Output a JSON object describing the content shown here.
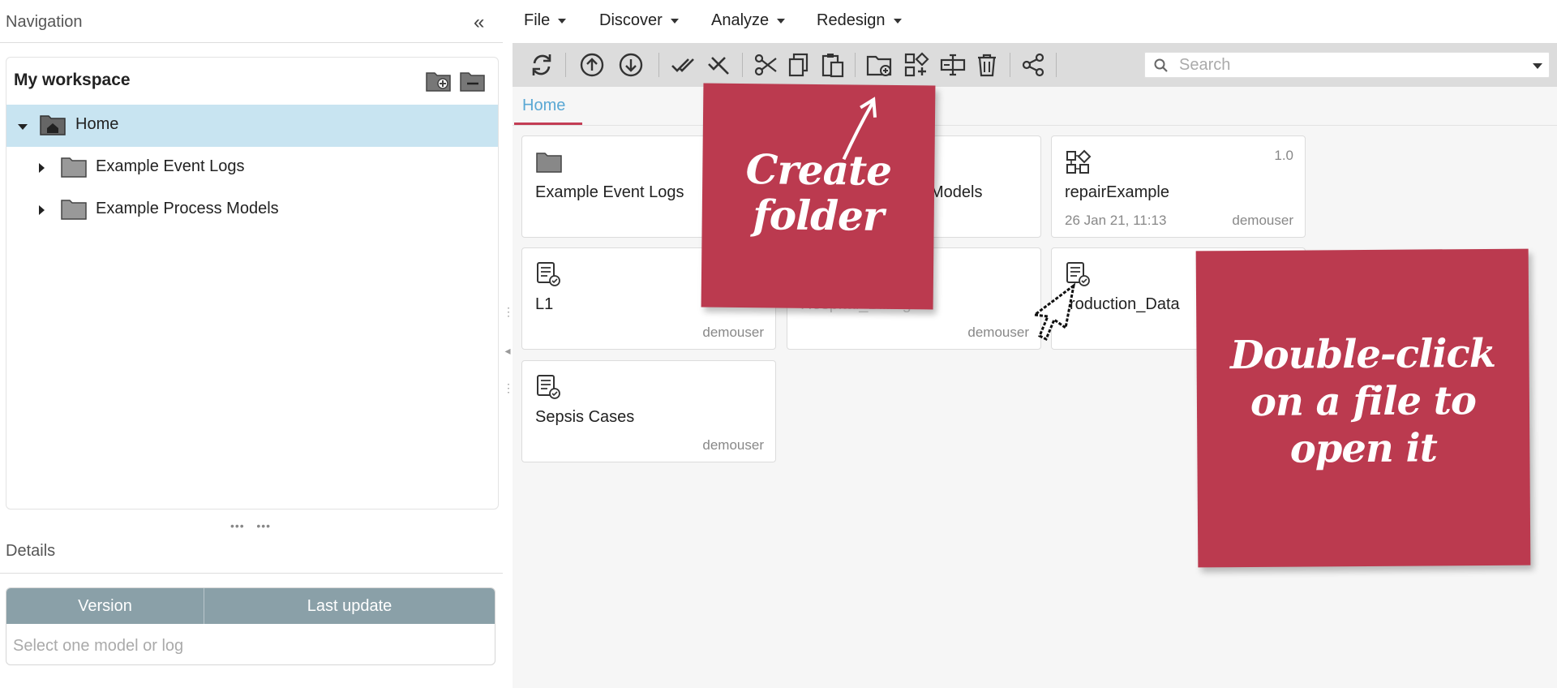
{
  "navigation": {
    "title": "Navigation",
    "collapse_icon": "double-chevron-left-icon",
    "workspace": {
      "title": "My workspace",
      "tree": [
        {
          "label": "Home",
          "selected": true,
          "expanded": true,
          "icon": "home-folder-icon"
        },
        {
          "label": "Example Event Logs",
          "selected": false,
          "expanded": false,
          "icon": "folder-icon"
        },
        {
          "label": "Example Process Models",
          "selected": false,
          "expanded": false,
          "icon": "folder-icon"
        }
      ]
    }
  },
  "details": {
    "title": "Details",
    "columns": [
      "Version",
      "Last update"
    ],
    "empty_text": "Select one model or log"
  },
  "menu": {
    "items": [
      "File",
      "Discover",
      "Analyze",
      "Redesign"
    ]
  },
  "toolbar": {
    "buttons": [
      "refresh-icon",
      "upload-icon",
      "download-icon",
      "select-all-icon",
      "deselect-all-icon",
      "cut-icon",
      "copy-icon",
      "paste-icon",
      "new-folder-icon",
      "new-model-icon",
      "rename-icon",
      "delete-icon",
      "share-icon"
    ]
  },
  "search": {
    "placeholder": "Search",
    "value": ""
  },
  "breadcrumb": {
    "home": "Home"
  },
  "cards": [
    {
      "name": "Example Event Logs",
      "type": "folder",
      "owner": "",
      "date": "",
      "version": ""
    },
    {
      "name": "Models",
      "type": "folder",
      "owner": "",
      "date": "",
      "version": ""
    },
    {
      "name": "repairExample",
      "type": "model",
      "owner": "demouser",
      "date": "26 Jan 21, 11:13",
      "version": "1.0"
    },
    {
      "name": "L1",
      "type": "log",
      "owner": "demouser",
      "date": "",
      "version": ""
    },
    {
      "name": "Hospital_Billing",
      "type": "log",
      "owner": "demouser",
      "date": "",
      "version": ""
    },
    {
      "name": "roduction_Data",
      "type": "log",
      "owner": "",
      "date": "",
      "version": ""
    },
    {
      "name": "Sepsis Cases",
      "type": "log",
      "owner": "demouser",
      "date": "",
      "version": ""
    }
  ],
  "notes": {
    "create": "Create folder",
    "create_lines": [
      "Create",
      "folder"
    ],
    "open_lines": [
      "Double-click",
      "on a file to",
      "open it"
    ]
  },
  "colors": {
    "accent": "#bb3a4f",
    "link": "#5aa8d4",
    "selection": "#c8e4f1",
    "table_header": "#8aa0a8"
  }
}
